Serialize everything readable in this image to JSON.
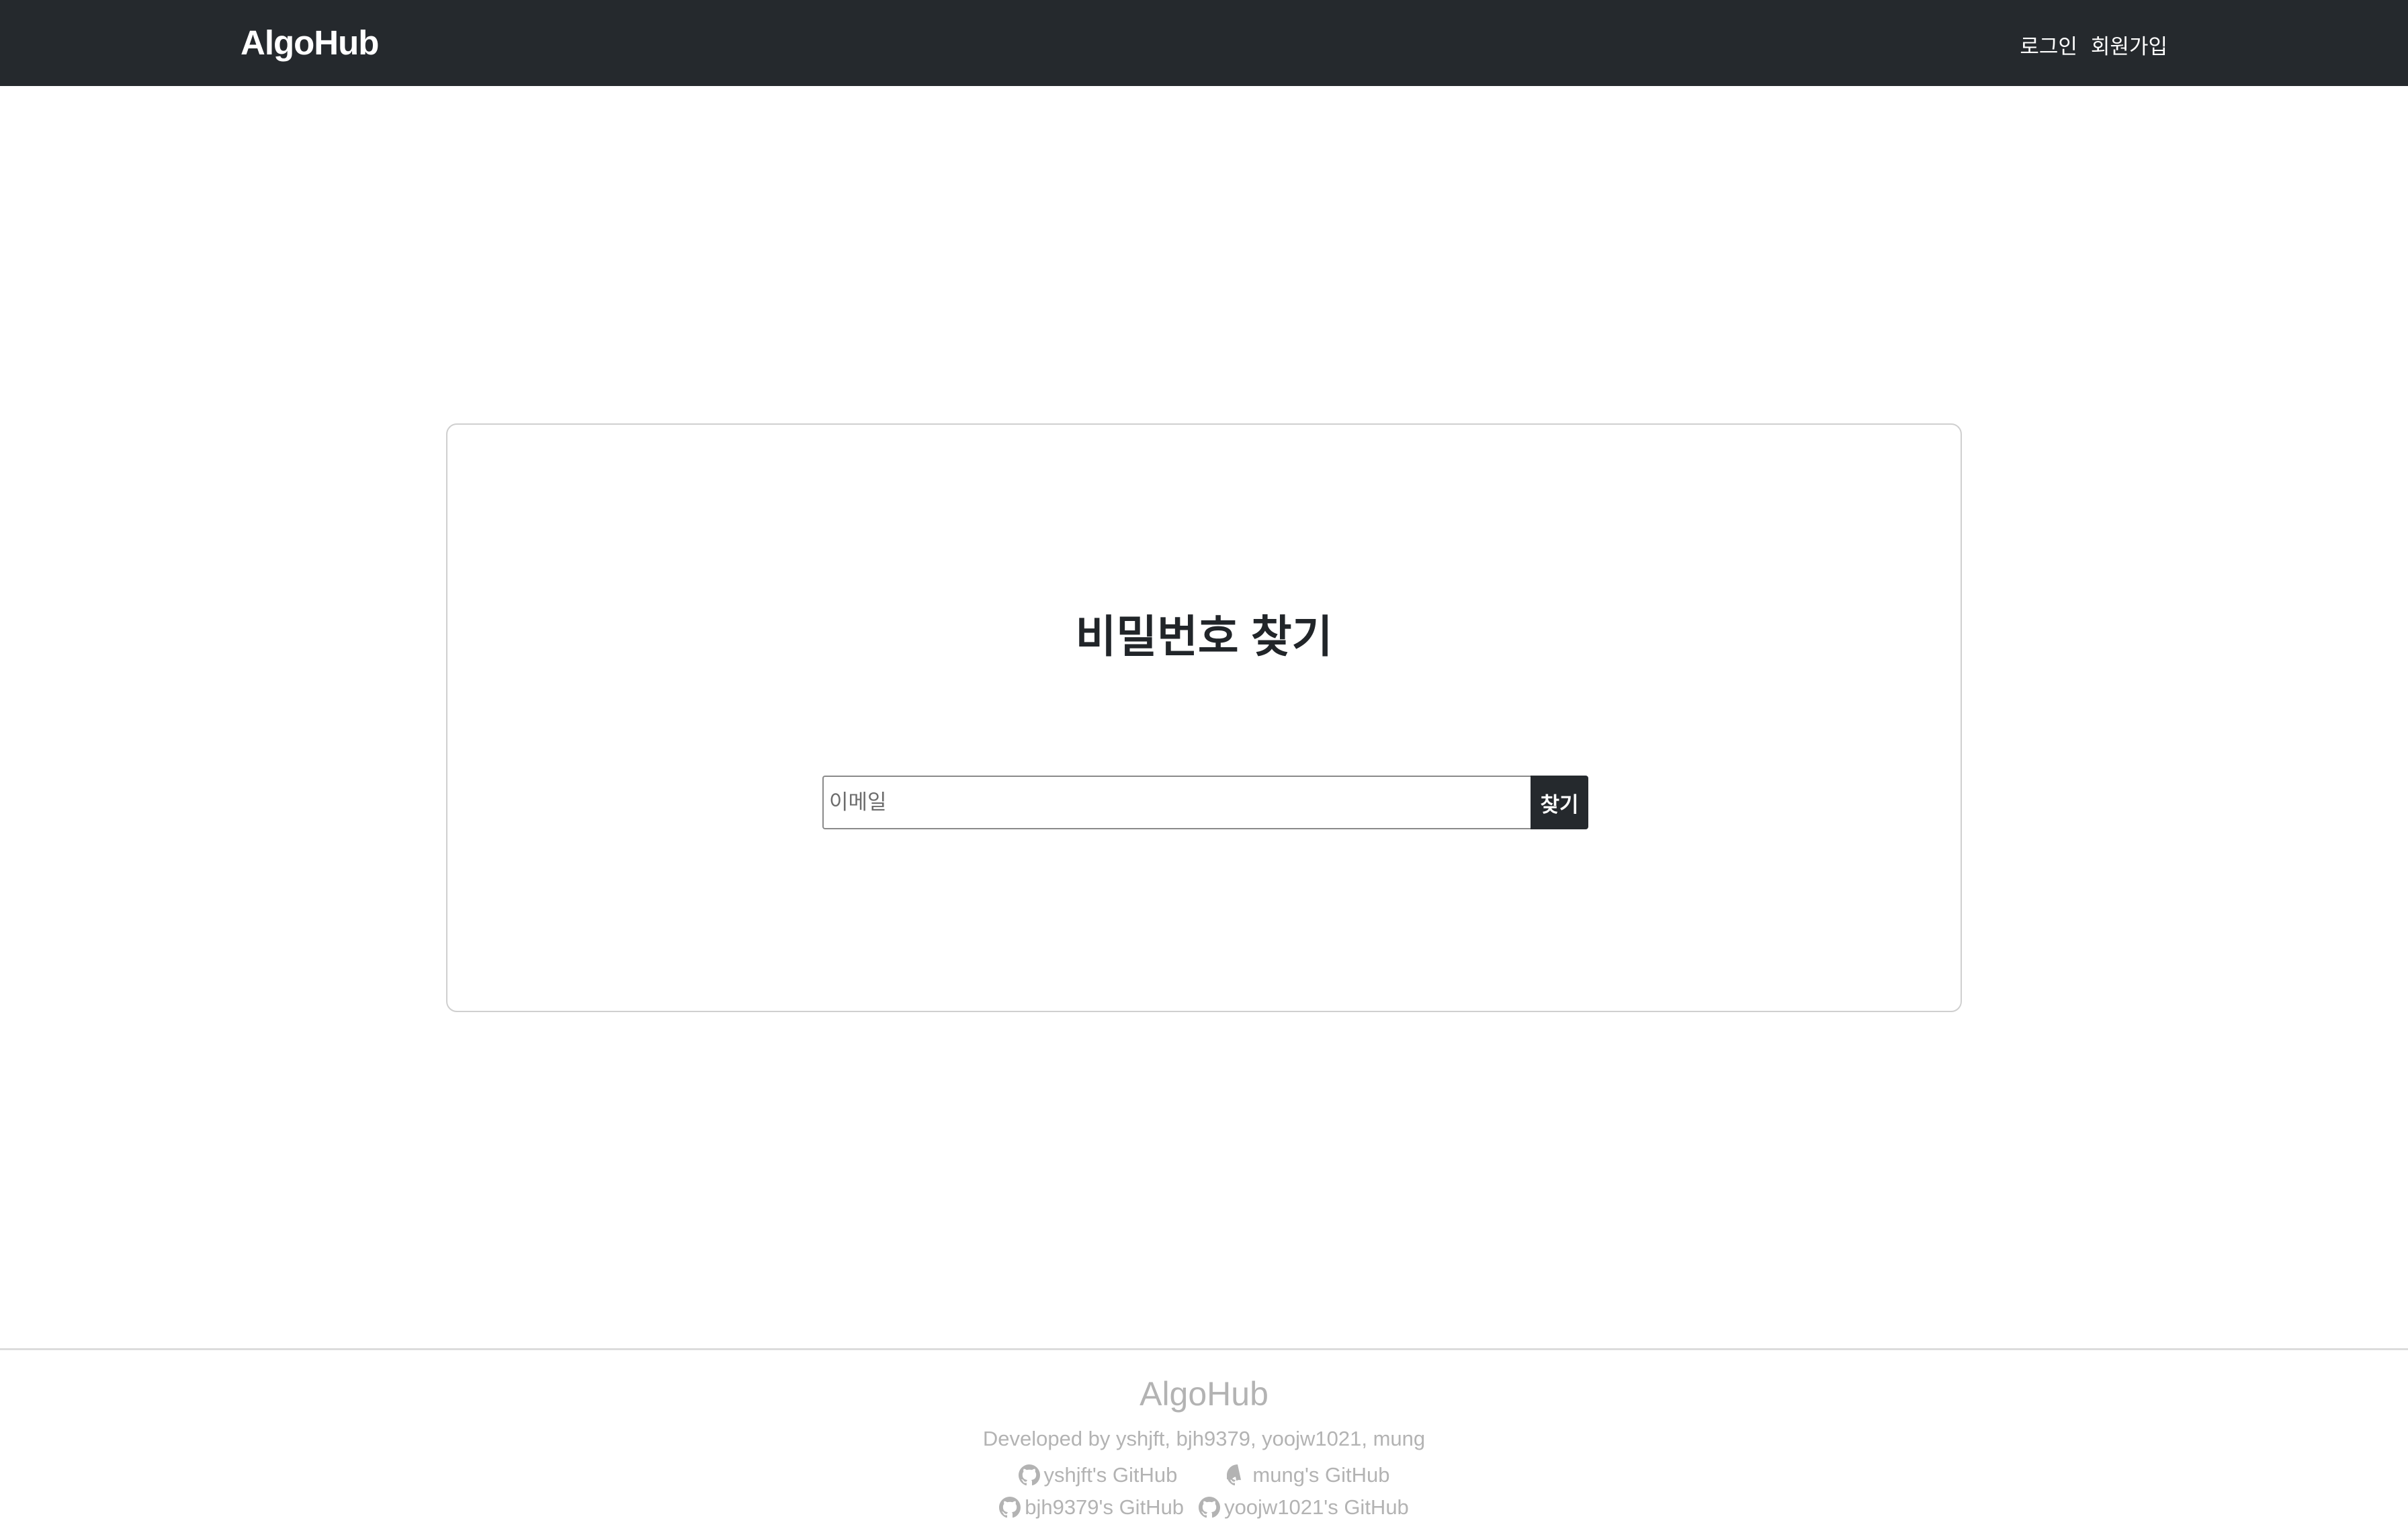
{
  "header": {
    "brand": "AlgoHub",
    "nav": {
      "login": "로그인",
      "signup": "회원가입"
    }
  },
  "card": {
    "title": "비밀번호 찾기",
    "email_placeholder": "이메일",
    "email_value": "",
    "find_label": "찾기"
  },
  "footer": {
    "brand": "AlgoHub",
    "developed_by": "Developed by yshjft, bjh9379, yoojw1021, mung",
    "github_links": [
      {
        "label": "yshjft's GitHub",
        "icon": "github-icon"
      },
      {
        "label": "mung's GitHub",
        "icon": "github-icon"
      },
      {
        "label": "bjh9379's GitHub",
        "icon": "github-icon"
      },
      {
        "label": "yoojw1021's GitHub",
        "icon": "github-icon"
      }
    ]
  },
  "colors": {
    "header_bg": "#25292d",
    "button_bg": "#25292d",
    "footer_text": "#b3b3b3"
  }
}
